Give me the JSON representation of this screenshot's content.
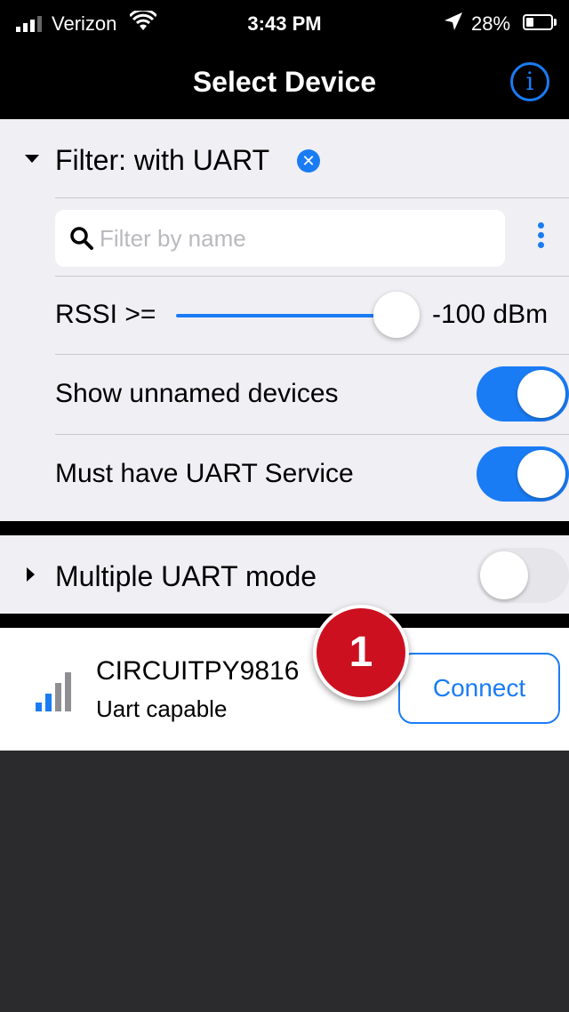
{
  "status_bar": {
    "carrier": "Verizon",
    "time": "3:43 PM",
    "battery": "28%"
  },
  "nav": {
    "title": "Select Device",
    "info_icon": "info-circle-icon"
  },
  "filter": {
    "title": "Filter: with UART",
    "search_placeholder": "Filter by name",
    "search_value": "",
    "rssi_label": "RSSI >=",
    "rssi_value": "-100 dBm",
    "rssi_slider_level": 1.0,
    "show_unnamed_label": "Show unnamed devices",
    "show_unnamed_on": true,
    "must_have_uart_label": "Must have UART Service",
    "must_have_uart_on": true
  },
  "multi_uart": {
    "label": "Multiple UART mode",
    "on": false
  },
  "devices": [
    {
      "name": "CIRCUITPY9816",
      "subtitle": "Uart capable",
      "signal_bars_active": 2,
      "connect_label": "Connect"
    }
  ],
  "callout": {
    "number": "1",
    "color": "#cc1020"
  },
  "colors": {
    "accent": "#1a7cf5",
    "panel_bg": "#efeff4",
    "nav_bg": "#000000"
  }
}
